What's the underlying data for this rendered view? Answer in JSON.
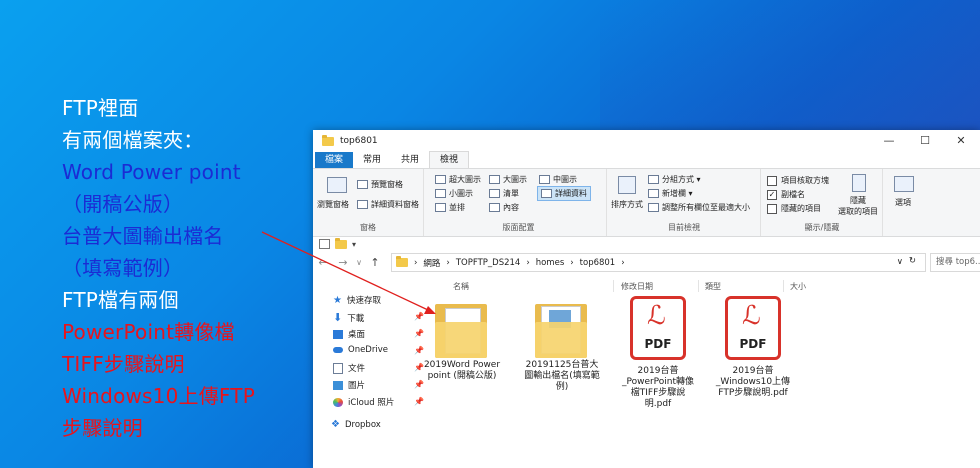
{
  "annotation": {
    "lines": [
      {
        "text": "FTP裡面",
        "color": "#ffffff"
      },
      {
        "text": "有兩個檔案夾：",
        "color": "#ffffff"
      },
      {
        "text": "Word Power point",
        "color": "#1b2bd4"
      },
      {
        "text": "（開稿公版）",
        "color": "#1b2bd4"
      },
      {
        "text": "台普大圖輸出檔名",
        "color": "#1b2bd4"
      },
      {
        "text": "（填寫範例）",
        "color": "#1b2bd4"
      },
      {
        "text": "FTP檔有兩個",
        "color": "#ffffff"
      },
      {
        "text": "PowerPoint轉像檔",
        "color": "#e8141c"
      },
      {
        "text": "TIFF步驟說明",
        "color": "#e8141c"
      },
      {
        "text": "Windows10上傳FTP",
        "color": "#e8141c"
      },
      {
        "text": "步驟說明",
        "color": "#e8141c"
      }
    ],
    "arrow_color": "#e0201e"
  },
  "window": {
    "title": "top6801",
    "minimize": "—",
    "maximize": "☐",
    "close": "✕"
  },
  "ribbon_tabs": [
    "檔案",
    "常用",
    "共用",
    "檢視"
  ],
  "ribbon": {
    "pane": {
      "nav_pane": "瀏覽窗格",
      "preview": "預覽窗格",
      "details": "詳細資料窗格",
      "label": "窗格"
    },
    "layout": {
      "items": [
        "超大圖示",
        "大圖示",
        "中圖示",
        "小圖示",
        "清單",
        "詳細資料",
        "並排",
        "內容"
      ],
      "label": "版面配置"
    },
    "current_view": {
      "sort": "排序方式",
      "group": "分組方式",
      "add_column": "新增欄",
      "fit_columns": "調整所有欄位至最適大小",
      "label": "目前檢視"
    },
    "show_hide": {
      "item_checkboxes": "項目核取方塊",
      "extensions": "副檔名",
      "hidden_items": "隱藏的項目",
      "hide_selected": "隱藏",
      "hide_selected_2": "選取的項目",
      "label": "顯示/隱藏"
    },
    "options": "選項"
  },
  "address": {
    "segments": [
      "網路",
      "TOPFTP_DS214",
      "homes",
      "top6801"
    ],
    "search_placeholder": "搜尋 top6..."
  },
  "nav_pane": [
    {
      "label": "快速存取",
      "icon": "star-icon"
    },
    {
      "label": "下載",
      "icon": "download-icon"
    },
    {
      "label": "桌面",
      "icon": "desktop-icon"
    },
    {
      "label": "OneDrive",
      "icon": "cloud-icon"
    },
    {
      "label": "文件",
      "icon": "document-icon"
    },
    {
      "label": "圖片",
      "icon": "picture-icon"
    },
    {
      "label": "iCloud 照片",
      "icon": "icloud-photos-icon"
    },
    {
      "label": "Dropbox",
      "icon": "dropbox-icon"
    }
  ],
  "columns": [
    "名稱",
    "修改日期",
    "類型",
    "大小"
  ],
  "files": [
    {
      "name": "2019Word Power point (開稿公版)",
      "type": "folder"
    },
    {
      "name": "20191125台普大圖輸出檔名(填寫範例)",
      "type": "folder"
    },
    {
      "name": "2019台普_PowerPoint轉像檔TIFF步驟說明.pdf",
      "type": "pdf",
      "badge": "PDF"
    },
    {
      "name": "2019台普_Windows10上傳FTP步驟說明.pdf",
      "type": "pdf",
      "badge": "PDF"
    }
  ]
}
